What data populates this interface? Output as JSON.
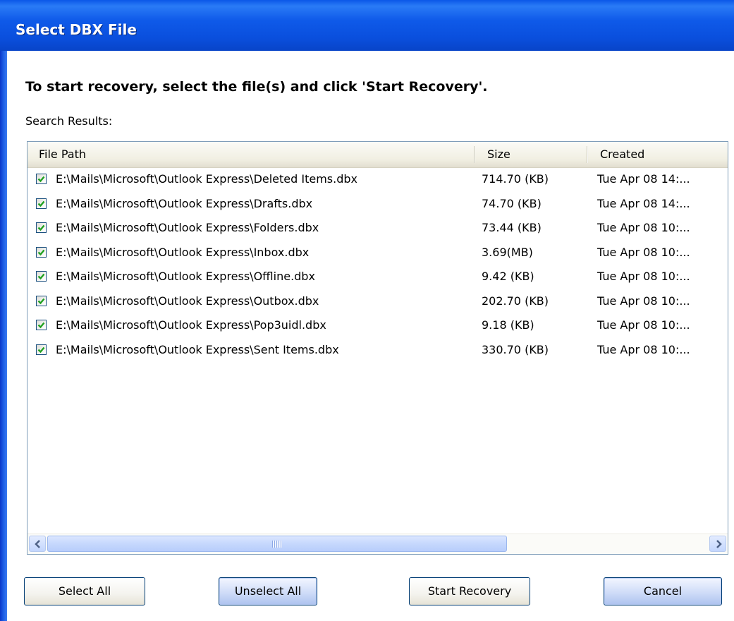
{
  "window": {
    "title": "Select DBX File"
  },
  "instruction": "To start recovery, select the file(s) and click 'Start Recovery'.",
  "results_label": "Search Results:",
  "columns": {
    "path": "File Path",
    "size": "Size",
    "created": "Created"
  },
  "rows": [
    {
      "checked": true,
      "path": "E:\\Mails\\Microsoft\\Outlook Express\\Deleted Items.dbx",
      "size": "714.70 (KB)",
      "created": "Tue Apr 08 14:..."
    },
    {
      "checked": true,
      "path": "E:\\Mails\\Microsoft\\Outlook Express\\Drafts.dbx",
      "size": "74.70 (KB)",
      "created": "Tue Apr 08 14:..."
    },
    {
      "checked": true,
      "path": "E:\\Mails\\Microsoft\\Outlook Express\\Folders.dbx",
      "size": "73.44 (KB)",
      "created": "Tue Apr 08 10:..."
    },
    {
      "checked": true,
      "path": "E:\\Mails\\Microsoft\\Outlook Express\\Inbox.dbx",
      "size": "3.69(MB)",
      "created": "Tue Apr 08 10:..."
    },
    {
      "checked": true,
      "path": "E:\\Mails\\Microsoft\\Outlook Express\\Offline.dbx",
      "size": "9.42 (KB)",
      "created": "Tue Apr 08 10:..."
    },
    {
      "checked": true,
      "path": "E:\\Mails\\Microsoft\\Outlook Express\\Outbox.dbx",
      "size": "202.70 (KB)",
      "created": "Tue Apr 08 10:..."
    },
    {
      "checked": true,
      "path": "E:\\Mails\\Microsoft\\Outlook Express\\Pop3uidl.dbx",
      "size": "9.18 (KB)",
      "created": "Tue Apr 08 10:..."
    },
    {
      "checked": true,
      "path": "E:\\Mails\\Microsoft\\Outlook Express\\Sent Items.dbx",
      "size": "330.70 (KB)",
      "created": "Tue Apr 08 10:..."
    }
  ],
  "buttons": {
    "select_all": "Select All",
    "unselect_all": "Unselect All",
    "start_recovery": "Start Recovery",
    "cancel": "Cancel"
  },
  "icons": {
    "checkbox": "checkmark-icon",
    "scroll_left": "chevron-left-icon",
    "scroll_right": "chevron-right-icon"
  },
  "colors": {
    "titlebar": "#0a4fdd",
    "checkmark": "#21a121"
  }
}
